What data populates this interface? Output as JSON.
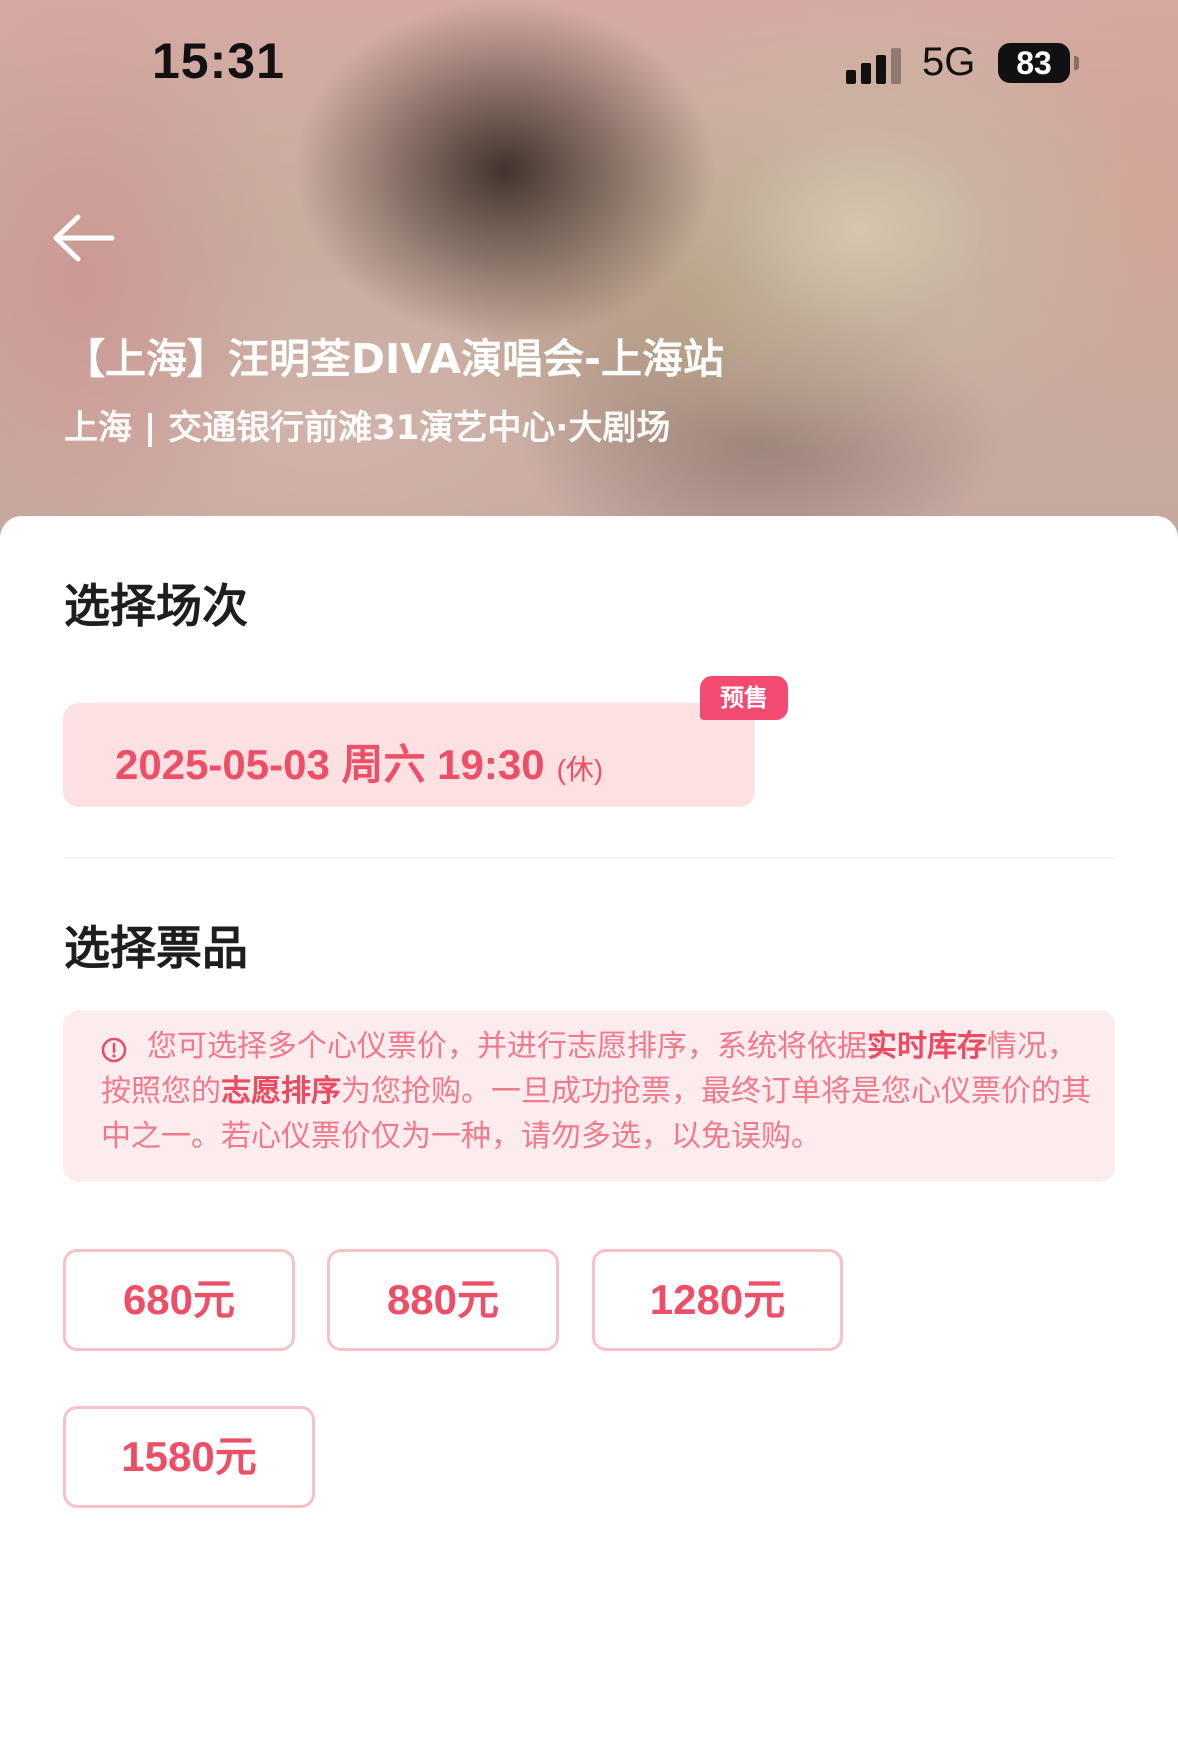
{
  "status_bar": {
    "time": "15:31",
    "network": "5G",
    "battery": "83"
  },
  "event": {
    "title": "【上海】汪明荃DIVA演唱会-上海站",
    "venue": "上海 | 交通银行前滩31演艺中心·大剧场"
  },
  "session_section": {
    "title": "选择场次",
    "sessions": [
      {
        "datetime": "2025-05-03 周六 19:30",
        "note": "(休)",
        "badge": "预售"
      }
    ]
  },
  "ticket_section": {
    "title": "选择票品",
    "notice": {
      "part1": "您可选择多个心仪票价，并进行志愿排序，系统将依据",
      "highlight1": "实时库存",
      "part2": "情况，按照您的",
      "highlight2": "志愿排序",
      "part3": "为您抢购。一旦成功抢票，最终订单将是您心仪票价的其中之一。若心仪票价仅为一种，请勿多选，以免误购。"
    },
    "prices": [
      "680元",
      "880元",
      "1280元",
      "1580元"
    ]
  },
  "colors": {
    "accent": "#ee4e66",
    "badge": "#f34a72",
    "chip_bg": "#fde0e2",
    "notice_bg": "#fdecee"
  },
  "icons": {
    "back": "arrow-left-icon",
    "notice": "info-circle-icon"
  }
}
